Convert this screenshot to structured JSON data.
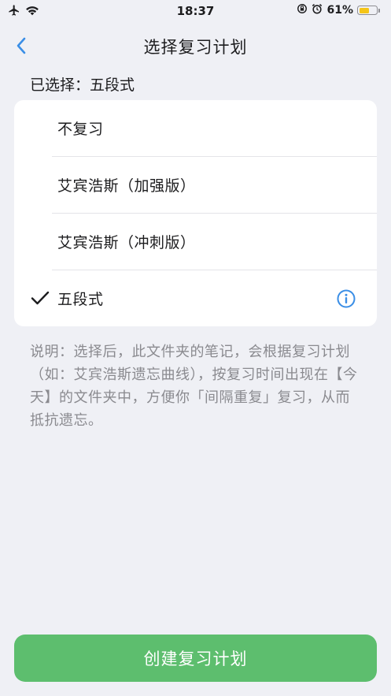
{
  "status_bar": {
    "time": "18:37",
    "battery_percent_label": "61%",
    "battery_level": 0.61,
    "icons": [
      "airplane-icon",
      "wifi-icon",
      "screen-lock-icon",
      "alarm-icon",
      "battery-icon"
    ]
  },
  "nav": {
    "title": "选择复习计划",
    "back_icon": "chevron-left-icon"
  },
  "selected": {
    "text": "已选择：五段式"
  },
  "options": [
    {
      "label": "不复习",
      "selected": false
    },
    {
      "label": "艾宾浩斯（加强版）",
      "selected": false
    },
    {
      "label": "艾宾浩斯（冲刺版）",
      "selected": false
    },
    {
      "label": "五段式",
      "selected": true,
      "has_info": true
    }
  ],
  "description": "说明：选择后，此文件夹的笔记，会根据复习计划（如：艾宾浩斯遗忘曲线），按复习时间出现在【今天】的文件夹中，方便你「间隔重复」复习，从而抵抗遗忘。",
  "create_button": {
    "label": "创建复习计划"
  },
  "colors": {
    "accent_blue": "#3a8ee6",
    "button_green": "#5dbe6e",
    "background": "#eff0f5",
    "battery_yellow": "#f5c518"
  }
}
